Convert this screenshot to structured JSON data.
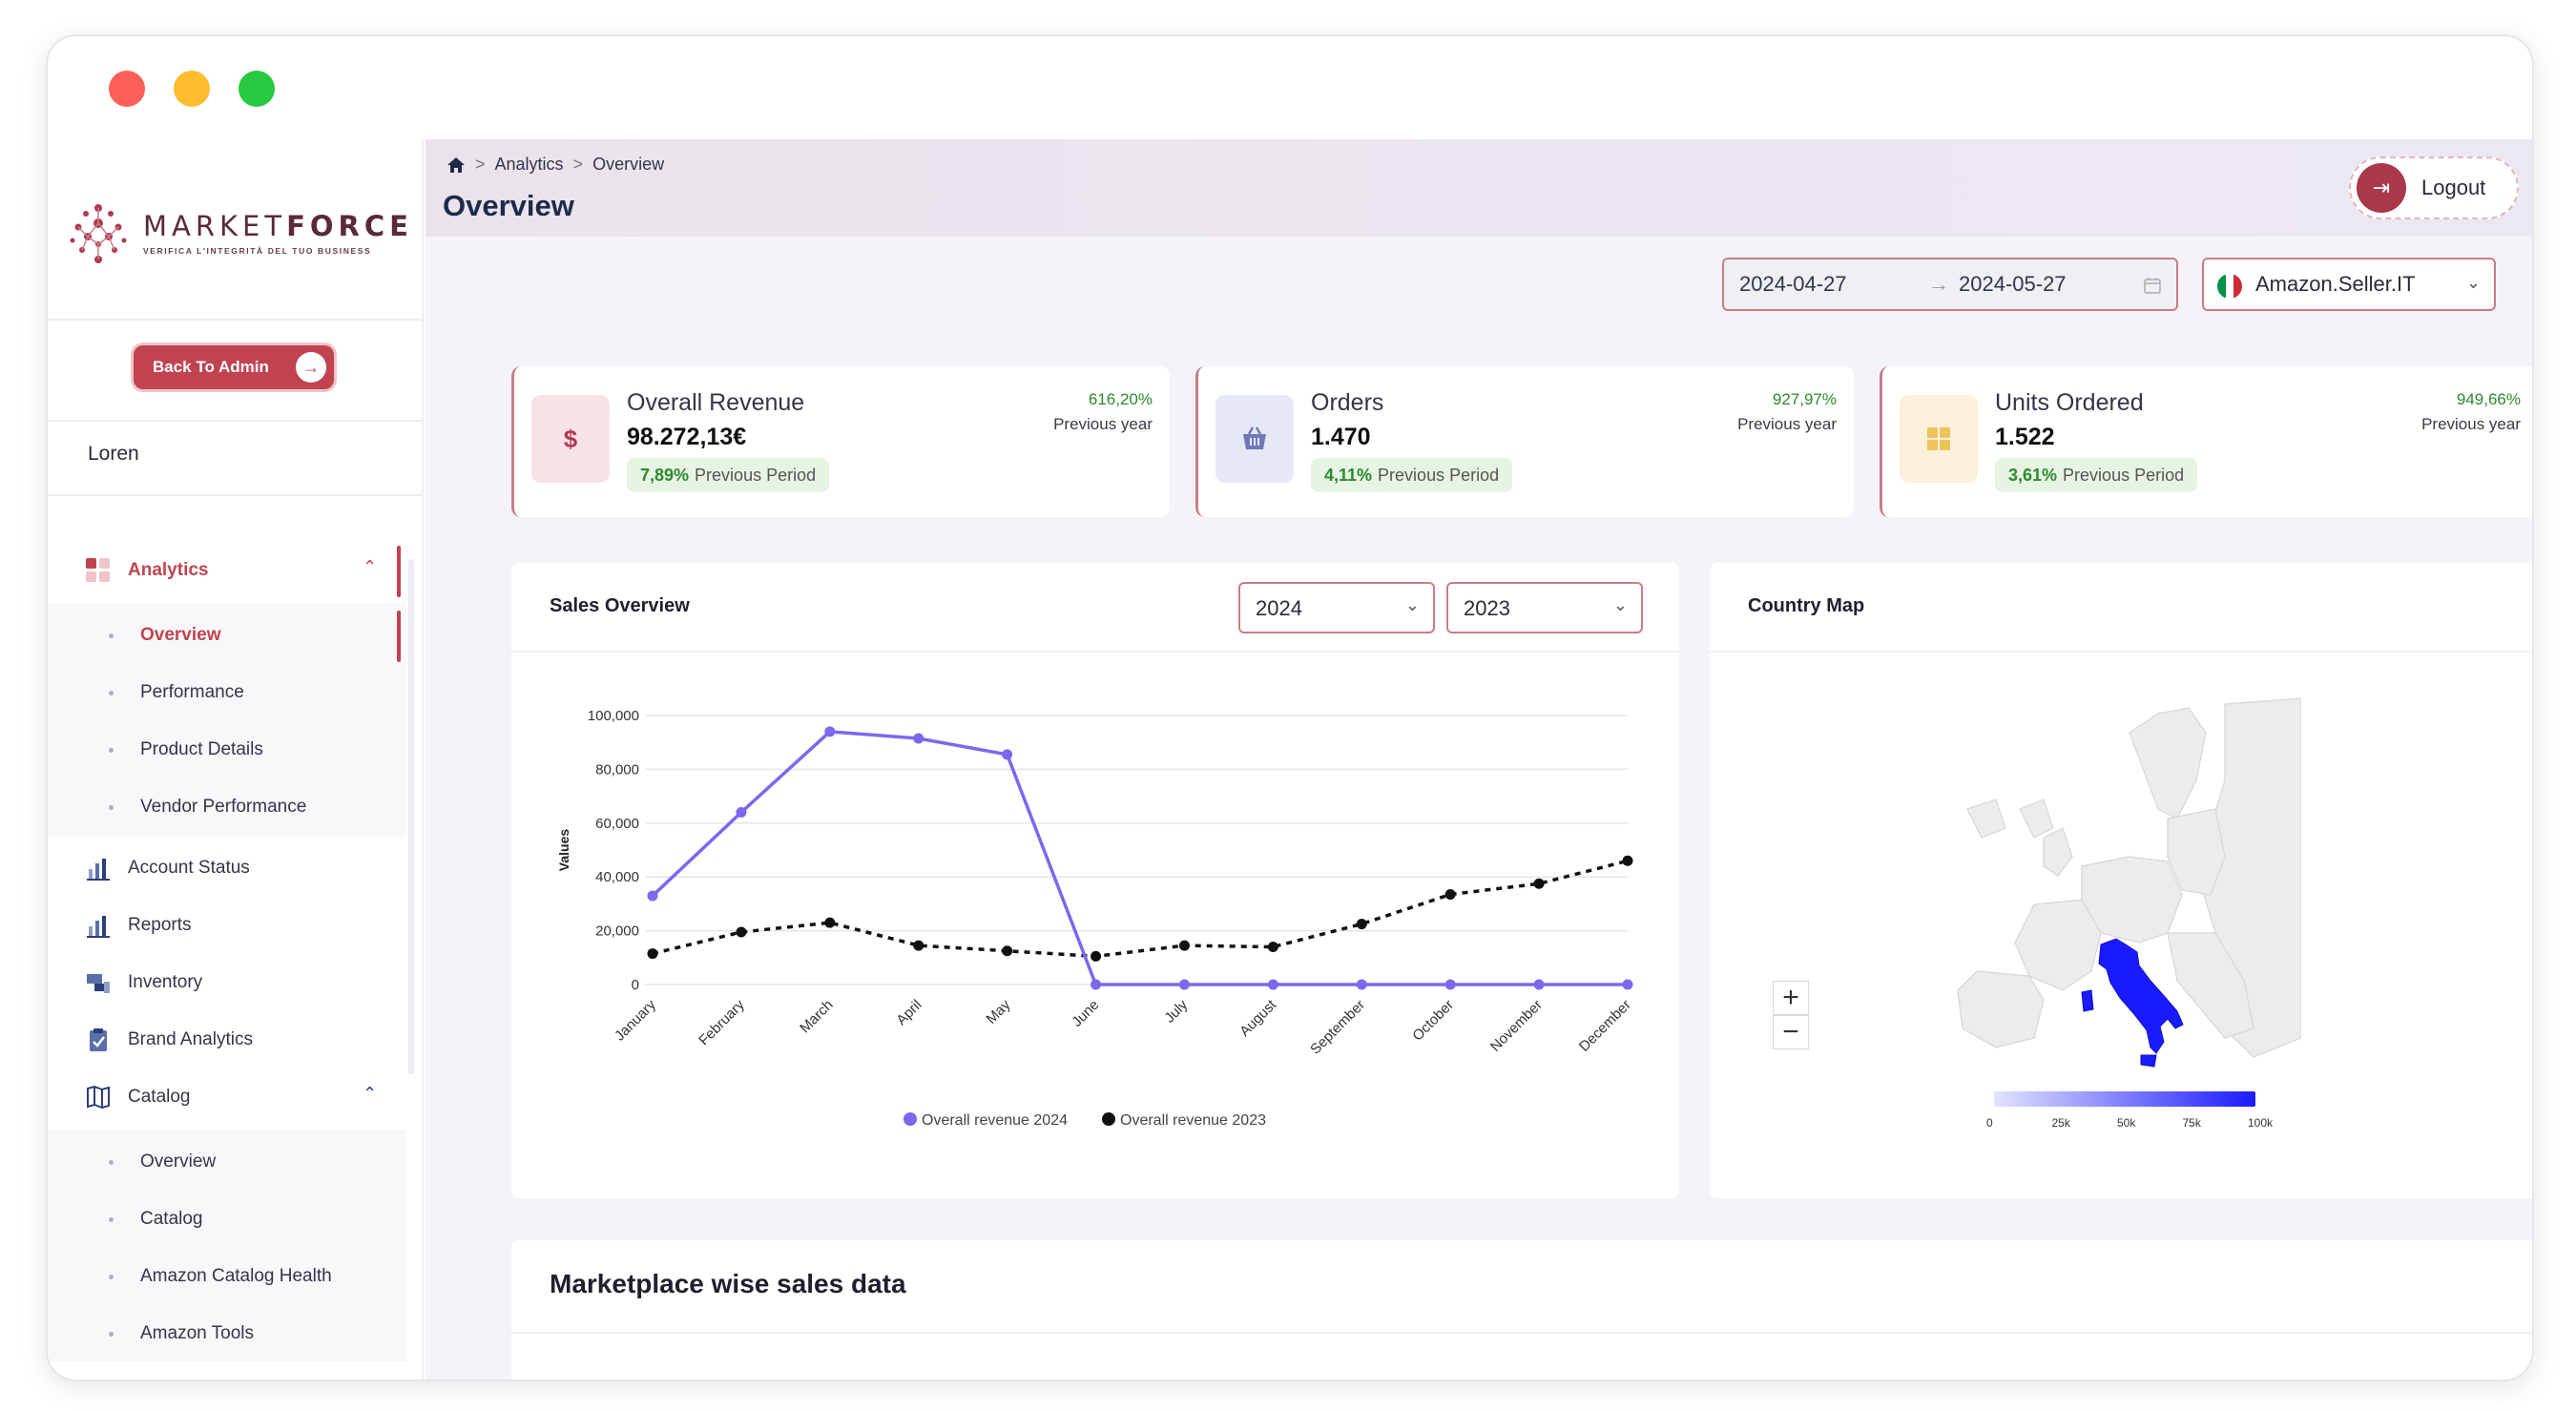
{
  "brand": {
    "name_light": "MARKET",
    "name_bold": "FORCE",
    "tagline": "VERIFICA L'INTEGRITÀ DEL TUO BUSINESS",
    "accent": "#c0434f"
  },
  "sidebar": {
    "back_button": "Back To Admin",
    "user": "Loren",
    "analytics": {
      "label": "Analytics",
      "items": [
        "Overview",
        "Performance",
        "Product Details",
        "Vendor Performance"
      ]
    },
    "items": [
      {
        "label": "Account Status",
        "icon": "bar-chart-icon"
      },
      {
        "label": "Reports",
        "icon": "bar-chart-icon"
      },
      {
        "label": "Inventory",
        "icon": "inventory-icon"
      },
      {
        "label": "Brand Analytics",
        "icon": "clipboard-check-icon"
      }
    ],
    "catalog": {
      "label": "Catalog",
      "items": [
        "Overview",
        "Catalog",
        "Amazon Catalog Health",
        "Amazon Tools"
      ]
    }
  },
  "header": {
    "breadcrumb": [
      "Analytics",
      "Overview"
    ],
    "title": "Overview",
    "logout": "Logout"
  },
  "filters": {
    "date_from": "2024-04-27",
    "date_to": "2024-05-27",
    "marketplace": "Amazon.Seller.IT"
  },
  "kpis": [
    {
      "label": "Overall Revenue",
      "value": "98.272,13€",
      "period_pct": "7,89%",
      "period_label": "Previous Period",
      "yoy_pct": "616,20%",
      "yoy_label": "Previous year",
      "icon": "dollar-icon",
      "icon_glyph": "$"
    },
    {
      "label": "Orders",
      "value": "1.470",
      "period_pct": "4,11%",
      "period_label": "Previous Period",
      "yoy_pct": "927,97%",
      "yoy_label": "Previous year",
      "icon": "basket-icon"
    },
    {
      "label": "Units Ordered",
      "value": "1.522",
      "period_pct": "3,61%",
      "period_label": "Previous Period",
      "yoy_pct": "949,66%",
      "yoy_label": "Previous year",
      "icon": "boxes-icon"
    }
  ],
  "sales_overview": {
    "title": "Sales Overview",
    "year_a": "2024",
    "year_b": "2023"
  },
  "country_map": {
    "title": "Country Map",
    "legend_ticks": [
      "0",
      "25k",
      "50k",
      "75k",
      "100k"
    ],
    "highlight_country": "Italy",
    "highlight_color": "#1a1aff"
  },
  "marketplace_section": {
    "title": "Marketplace wise sales data"
  },
  "chart_data": {
    "type": "line",
    "categories": [
      "January",
      "February",
      "March",
      "April",
      "May",
      "June",
      "July",
      "August",
      "September",
      "October",
      "November",
      "December"
    ],
    "ylabel": "Values",
    "ylim": [
      0,
      100000
    ],
    "yticks": [
      "100,000",
      "80,000",
      "60,000",
      "40,000",
      "20,000",
      "0"
    ],
    "ytick_values": [
      100000,
      80000,
      60000,
      40000,
      20000,
      0
    ],
    "grid": true,
    "legend": "bottom",
    "series": [
      {
        "name": "Overall revenue 2024",
        "color": "#7b68ee",
        "style": "solid",
        "values": [
          33000,
          64000,
          94000,
          91500,
          85500,
          0,
          0,
          0,
          0,
          0,
          0,
          0
        ]
      },
      {
        "name": "Overall revenue 2023",
        "color": "#111111",
        "style": "dashed",
        "values": [
          11500,
          19500,
          23000,
          14500,
          12500,
          10500,
          14500,
          14000,
          22500,
          33500,
          37500,
          46000
        ]
      }
    ]
  }
}
